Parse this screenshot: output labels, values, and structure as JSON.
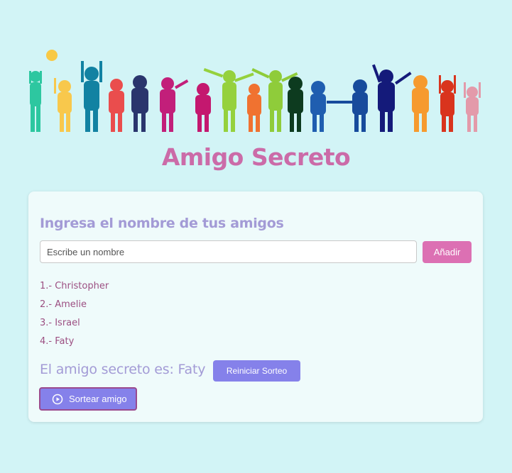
{
  "header": {
    "banner_image": "children-silhouettes-holding-hands",
    "title": "Amigo Secreto"
  },
  "form": {
    "section_title": "Ingresa el nombre de tus amigos",
    "input_placeholder": "Escribe un nombre",
    "input_value": "",
    "add_button_label": "Añadir"
  },
  "friends": [
    "1.- Christopher",
    "2.- Amelie",
    "3.- Israel",
    "4.- Faty"
  ],
  "result": {
    "text": "El amigo secreto es: Faty",
    "reset_button_label": "Reiniciar Sorteo"
  },
  "draw_button": {
    "icon": "play-circle-icon",
    "label": "Sortear amigo"
  },
  "colors": {
    "background": "#d2f4f6",
    "card": "#effbfb",
    "title": "#cb6ba8",
    "section_title": "#a39bd6",
    "add_button": "#dc70b3",
    "action_button": "#8581ea",
    "list_text": "#9c4f82"
  }
}
